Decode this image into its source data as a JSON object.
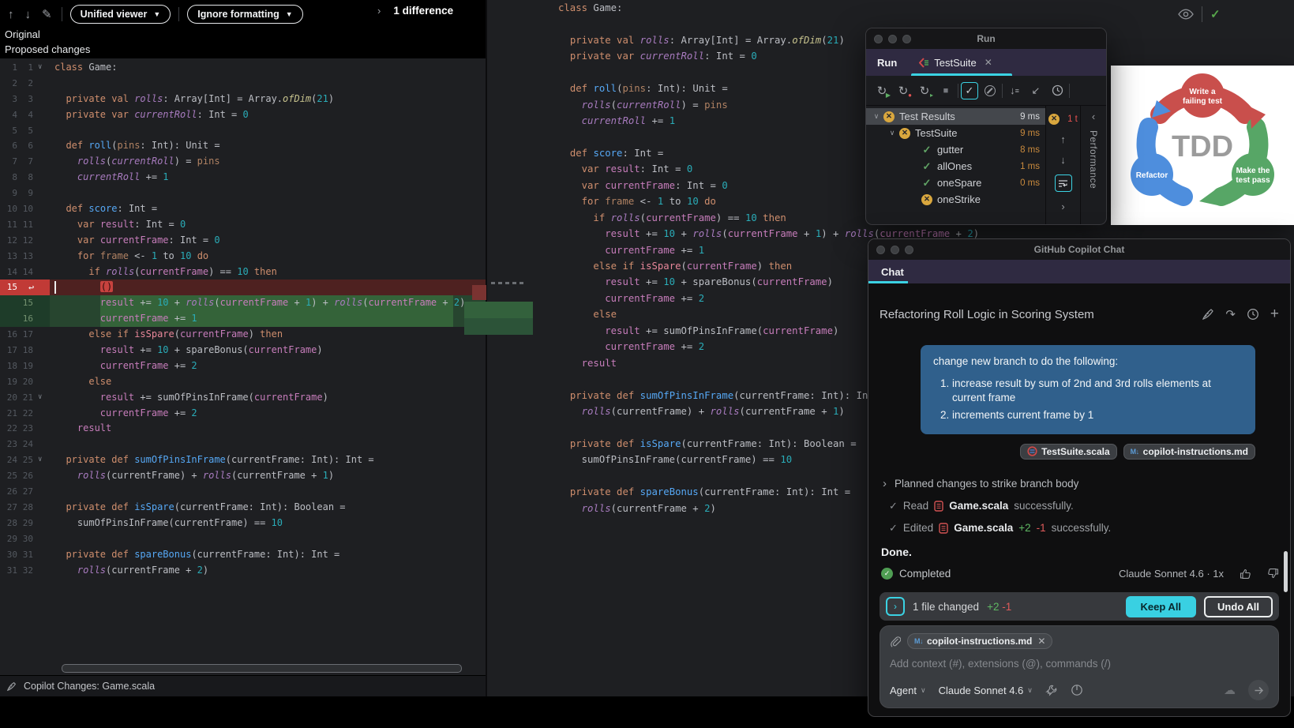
{
  "colors": {
    "accent_cyan": "#3bd2e3",
    "add_green": "#27452f",
    "del_red": "#4e2120",
    "fail_yellow": "#d9a73e",
    "pass_green": "#61a365",
    "bubble_blue": "#30608c",
    "keep_all_bg": "#39d0e2"
  },
  "diff_pane": {
    "toolbar": {
      "viewer_mode": "Unified viewer",
      "formatting": "Ignore formatting",
      "differences": "1 difference"
    },
    "labels": {
      "original": "Original",
      "proposed": "Proposed changes"
    },
    "status": "Copilot Changes: Game.scala"
  },
  "code": {
    "rows": [
      {
        "o": "1",
        "n": "1",
        "fold": true,
        "T": [
          [
            "k",
            "class"
          ],
          [
            "d",
            " Game:"
          ]
        ]
      },
      {
        "o": "2",
        "n": "2",
        "T": []
      },
      {
        "o": "3",
        "n": "3",
        "T": [
          [
            "d",
            "  "
          ],
          [
            "k",
            "private"
          ],
          [
            "d",
            " "
          ],
          [
            "k",
            "val"
          ],
          [
            "d",
            " "
          ],
          [
            "f",
            "rolls"
          ],
          [
            "d",
            ": Array[Int] = Array."
          ],
          [
            "st",
            "ofDim"
          ],
          [
            "d",
            "("
          ],
          [
            "n",
            "21"
          ],
          [
            "d",
            ")"
          ]
        ]
      },
      {
        "o": "4",
        "n": "4",
        "T": [
          [
            "d",
            "  "
          ],
          [
            "k",
            "private"
          ],
          [
            "d",
            " "
          ],
          [
            "k",
            "var"
          ],
          [
            "d",
            " "
          ],
          [
            "f",
            "currentRoll"
          ],
          [
            "d",
            ": Int = "
          ],
          [
            "n",
            "0"
          ]
        ]
      },
      {
        "o": "5",
        "n": "5",
        "T": []
      },
      {
        "o": "6",
        "n": "6",
        "T": [
          [
            "d",
            "  "
          ],
          [
            "k",
            "def"
          ],
          [
            "d",
            " "
          ],
          [
            "fn",
            "roll"
          ],
          [
            "d",
            "("
          ],
          [
            "p",
            "pins"
          ],
          [
            "d",
            ": Int): Unit ="
          ]
        ]
      },
      {
        "o": "7",
        "n": "7",
        "T": [
          [
            "d",
            "    "
          ],
          [
            "f",
            "rolls"
          ],
          [
            "d",
            "("
          ],
          [
            "f",
            "currentRoll"
          ],
          [
            "d",
            ") = "
          ],
          [
            "p",
            "pins"
          ]
        ]
      },
      {
        "o": "8",
        "n": "8",
        "T": [
          [
            "d",
            "    "
          ],
          [
            "f",
            "currentRoll"
          ],
          [
            "d",
            " += "
          ],
          [
            "n",
            "1"
          ]
        ]
      },
      {
        "o": "9",
        "n": "9",
        "T": []
      },
      {
        "o": "10",
        "n": "10",
        "T": [
          [
            "d",
            "  "
          ],
          [
            "k",
            "def"
          ],
          [
            "d",
            " "
          ],
          [
            "fn",
            "score"
          ],
          [
            "d",
            ": Int ="
          ]
        ]
      },
      {
        "o": "11",
        "n": "11",
        "T": [
          [
            "d",
            "    "
          ],
          [
            "k",
            "var"
          ],
          [
            "d",
            " "
          ],
          [
            "l",
            "result"
          ],
          [
            "d",
            ": Int = "
          ],
          [
            "n",
            "0"
          ]
        ]
      },
      {
        "o": "12",
        "n": "12",
        "T": [
          [
            "d",
            "    "
          ],
          [
            "k",
            "var"
          ],
          [
            "d",
            " "
          ],
          [
            "l",
            "currentFrame"
          ],
          [
            "d",
            ": Int = "
          ],
          [
            "n",
            "0"
          ]
        ]
      },
      {
        "o": "13",
        "n": "13",
        "T": [
          [
            "d",
            "    "
          ],
          [
            "k",
            "for"
          ],
          [
            "d",
            " "
          ],
          [
            "p",
            "frame"
          ],
          [
            "d",
            " <- "
          ],
          [
            "n",
            "1"
          ],
          [
            "d",
            " to "
          ],
          [
            "n",
            "10"
          ],
          [
            "d",
            " "
          ],
          [
            "k",
            "do"
          ]
        ]
      },
      {
        "o": "14",
        "n": "14",
        "T": [
          [
            "d",
            "      "
          ],
          [
            "k",
            "if"
          ],
          [
            "d",
            " "
          ],
          [
            "f",
            "rolls"
          ],
          [
            "d",
            "("
          ],
          [
            "l",
            "currentFrame"
          ],
          [
            "d",
            ") == "
          ],
          [
            "n",
            "10"
          ],
          [
            "d",
            " "
          ],
          [
            "k",
            "then"
          ]
        ]
      },
      {
        "o": "15",
        "type": "del",
        "caret": true,
        "T": [
          [
            "d",
            "        "
          ],
          [
            "x",
            "()"
          ]
        ]
      },
      {
        "n": "15",
        "type": "add",
        "T": [
          [
            "d",
            "        "
          ],
          [
            "l",
            "result"
          ],
          [
            "d",
            " += "
          ],
          [
            "n",
            "10"
          ],
          [
            "d",
            " + "
          ],
          [
            "f",
            "rolls"
          ],
          [
            "d",
            "("
          ],
          [
            "l",
            "currentFrame"
          ],
          [
            "d",
            " + "
          ],
          [
            "n",
            "1"
          ],
          [
            "d",
            ") + "
          ],
          [
            "f",
            "rolls"
          ],
          [
            "d",
            "("
          ],
          [
            "l",
            "currentFrame"
          ],
          [
            "d",
            " + "
          ],
          [
            "n",
            "2"
          ],
          [
            "d",
            ")"
          ]
        ]
      },
      {
        "n": "16",
        "type": "add",
        "T": [
          [
            "d",
            "        "
          ],
          [
            "l",
            "currentFrame"
          ],
          [
            "d",
            " += "
          ],
          [
            "n",
            "1"
          ]
        ]
      },
      {
        "o": "16",
        "n": "17",
        "T": [
          [
            "d",
            "      "
          ],
          [
            "k",
            "else"
          ],
          [
            "d",
            " "
          ],
          [
            "k",
            "if"
          ],
          [
            "d",
            " "
          ],
          [
            "c",
            "isSpare"
          ],
          [
            "d",
            "("
          ],
          [
            "l",
            "currentFrame"
          ],
          [
            "d",
            ") "
          ],
          [
            "k",
            "then"
          ]
        ]
      },
      {
        "o": "17",
        "n": "18",
        "T": [
          [
            "d",
            "        "
          ],
          [
            "l",
            "result"
          ],
          [
            "d",
            " += "
          ],
          [
            "n",
            "10"
          ],
          [
            "d",
            " + spareBonus("
          ],
          [
            "l",
            "currentFrame"
          ],
          [
            "d",
            ")"
          ]
        ]
      },
      {
        "o": "18",
        "n": "19",
        "T": [
          [
            "d",
            "        "
          ],
          [
            "l",
            "currentFrame"
          ],
          [
            "d",
            " += "
          ],
          [
            "n",
            "2"
          ]
        ]
      },
      {
        "o": "19",
        "n": "20",
        "T": [
          [
            "d",
            "      "
          ],
          [
            "k",
            "else"
          ]
        ]
      },
      {
        "o": "20",
        "n": "21",
        "fold": true,
        "T": [
          [
            "d",
            "        "
          ],
          [
            "l",
            "result"
          ],
          [
            "d",
            " += sumOfPinsInFrame("
          ],
          [
            "l",
            "currentFrame"
          ],
          [
            "d",
            ")"
          ]
        ]
      },
      {
        "o": "21",
        "n": "22",
        "T": [
          [
            "d",
            "        "
          ],
          [
            "l",
            "currentFrame"
          ],
          [
            "d",
            " += "
          ],
          [
            "n",
            "2"
          ]
        ]
      },
      {
        "o": "22",
        "n": "23",
        "T": [
          [
            "d",
            "    "
          ],
          [
            "l",
            "result"
          ]
        ]
      },
      {
        "o": "23",
        "n": "24",
        "T": []
      },
      {
        "o": "24",
        "n": "25",
        "fold": true,
        "T": [
          [
            "d",
            "  "
          ],
          [
            "k",
            "private"
          ],
          [
            "d",
            " "
          ],
          [
            "k",
            "def"
          ],
          [
            "d",
            " "
          ],
          [
            "fn",
            "sumOfPinsInFrame"
          ],
          [
            "d",
            "(currentFrame: Int): Int ="
          ]
        ]
      },
      {
        "o": "25",
        "n": "26",
        "T": [
          [
            "d",
            "    "
          ],
          [
            "f",
            "rolls"
          ],
          [
            "d",
            "(currentFrame) + "
          ],
          [
            "f",
            "rolls"
          ],
          [
            "d",
            "(currentFrame + "
          ],
          [
            "n",
            "1"
          ],
          [
            "d",
            ")"
          ]
        ]
      },
      {
        "o": "26",
        "n": "27",
        "T": []
      },
      {
        "o": "27",
        "n": "28",
        "T": [
          [
            "d",
            "  "
          ],
          [
            "k",
            "private"
          ],
          [
            "d",
            " "
          ],
          [
            "k",
            "def"
          ],
          [
            "d",
            " "
          ],
          [
            "fn",
            "isSpare"
          ],
          [
            "d",
            "(currentFrame: Int): Boolean ="
          ]
        ]
      },
      {
        "o": "28",
        "n": "29",
        "T": [
          [
            "d",
            "    sumOfPinsInFrame(currentFrame) == "
          ],
          [
            "n",
            "10"
          ]
        ]
      },
      {
        "o": "29",
        "n": "30",
        "T": []
      },
      {
        "o": "30",
        "n": "31",
        "T": [
          [
            "d",
            "  "
          ],
          [
            "k",
            "private"
          ],
          [
            "d",
            " "
          ],
          [
            "k",
            "def"
          ],
          [
            "d",
            " "
          ],
          [
            "fn",
            "spareBonus"
          ],
          [
            "d",
            "(currentFrame: Int): Int ="
          ]
        ]
      },
      {
        "o": "31",
        "n": "32",
        "T": [
          [
            "d",
            "    "
          ],
          [
            "f",
            "rolls"
          ],
          [
            "d",
            "(currentFrame + "
          ],
          [
            "n",
            "2"
          ],
          [
            "d",
            ")"
          ]
        ]
      }
    ]
  },
  "run_window": {
    "title": "Run",
    "tool_label": "Run",
    "tab": "TestSuite",
    "fail_count": "1 t",
    "side_tab": "Performance",
    "tree": [
      {
        "level": 0,
        "icon": "fail",
        "chevron": true,
        "label": "Test Results",
        "time": "9 ms",
        "selected": true
      },
      {
        "level": 1,
        "icon": "fail",
        "chevron": true,
        "label": "TestSuite",
        "time": "9 ms"
      },
      {
        "level": 2,
        "icon": "pass",
        "label": "gutter",
        "time": "8 ms"
      },
      {
        "level": 2,
        "icon": "pass",
        "label": "allOnes",
        "time": "1 ms"
      },
      {
        "level": 2,
        "icon": "pass",
        "label": "oneSpare",
        "time": "0 ms"
      },
      {
        "level": 2,
        "icon": "fail",
        "label": "oneStrike",
        "time": ""
      }
    ]
  },
  "tdd": {
    "center": "TDD",
    "top1": "Write a",
    "top2": "failing test",
    "right1": "Make the",
    "right2": "test pass",
    "left": "Refactor",
    "red": "#c94f4c",
    "green": "#57a666",
    "blue": "#4e8edd"
  },
  "chat_window": {
    "title": "GitHub Copilot Chat",
    "tab": "Chat",
    "thread_title": "Refactoring Roll Logic in Scoring System",
    "user_message": {
      "intro": "change new branch to do the following:",
      "items": [
        "increase result by sum of 2nd and 3rd rolls elements at current frame",
        "increments current frame by 1"
      ]
    },
    "attachments": {
      "scala_file": "TestSuite.scala",
      "md_file": "copilot-instructions.md"
    },
    "planned": "Planned changes to strike branch body",
    "read": {
      "verb": "Read",
      "file": "Game.scala",
      "suffix": "successfully."
    },
    "edited": {
      "verb": "Edited",
      "file": "Game.scala",
      "plus": "+2",
      "minus": "-1",
      "suffix": "successfully."
    },
    "done": "Done.",
    "completed": "Completed",
    "model_usage": "Claude Sonnet 4.6 · 1x",
    "changes_bar": {
      "text": "1 file changed",
      "plus": "+2",
      "minus": "-1",
      "keep": "Keep All",
      "undo": "Undo All"
    },
    "input": {
      "chip": "copilot-instructions.md",
      "placeholder": "Add context (#), extensions (@), commands (/)",
      "mode": "Agent",
      "model": "Claude Sonnet 4.6"
    }
  }
}
